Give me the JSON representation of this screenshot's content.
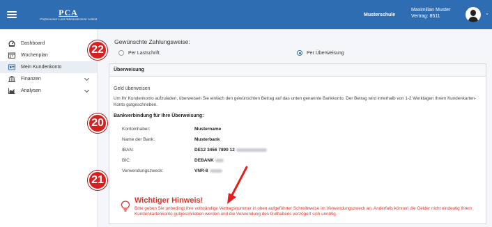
{
  "header": {
    "logo_mark": "PCA",
    "logo_sub": "Professional Card Administration GmbH",
    "school": "Musterschule",
    "user_name": "Maximilian Muster",
    "user_contract": "Vertrag: 8511",
    "bg_color": "#2f6db2"
  },
  "sidebar": {
    "items": [
      {
        "label": "Dashboard",
        "icon": "dashboard-icon"
      },
      {
        "label": "Wochenplan",
        "icon": "calendar-icon"
      },
      {
        "label": "Mein Kundenkonto",
        "icon": "account-card-icon",
        "active": true
      },
      {
        "label": "Finanzen",
        "icon": "bank-icon",
        "expandable": true
      },
      {
        "label": "Analysen",
        "icon": "chart-icon",
        "expandable": true
      }
    ]
  },
  "payment": {
    "title": "Gewünschte Zahlungsweise:",
    "option_debit": "Per Lastschrift",
    "option_transfer": "Per Überweisung",
    "selected": "transfer"
  },
  "card": {
    "header": "Überweisung",
    "geld_title": "Geld überweisen",
    "description": "Um Ihr Kundenkonto aufzuladen, überweisen Sie einfach den gewünschten Betrag auf das unten genannte Bankkonto. Der Betrag wird innerhalb von 1-2 Werktagen Ihrem Kundenkarten-Konto gutgeschrieben.",
    "bank_title": "Bankverbindung für Ihre Überweisung:",
    "rows": [
      {
        "key": "Kontoinhaber:",
        "value": "Mustername"
      },
      {
        "key": "Name der Bank:",
        "value": "Musterbank"
      },
      {
        "key": "IBAN:",
        "value": "DE12 3456 7890 12"
      },
      {
        "key": "BIC:",
        "value": "DEBANK"
      },
      {
        "key": "Verwendungszweck:",
        "value": "VNR-8"
      }
    ],
    "warning_title": "Wichtiger Hinweis!",
    "warning_text": "Bitte geben Sie unbedingt Ihre vollständige Vertragsnummer in oben aufgeführter Schreibweise im Verwendungszweck an. Anderfalls können die Gelder nicht eindeutig Ihrem Kundenkartenkonto gutgeschrieben werden und die Verwendung des Guthabens verzögert sich unnötig.",
    "warning_color": "#d9362b"
  },
  "badges": [
    "22",
    "20",
    "21"
  ],
  "accent_color": "#d81f1f"
}
